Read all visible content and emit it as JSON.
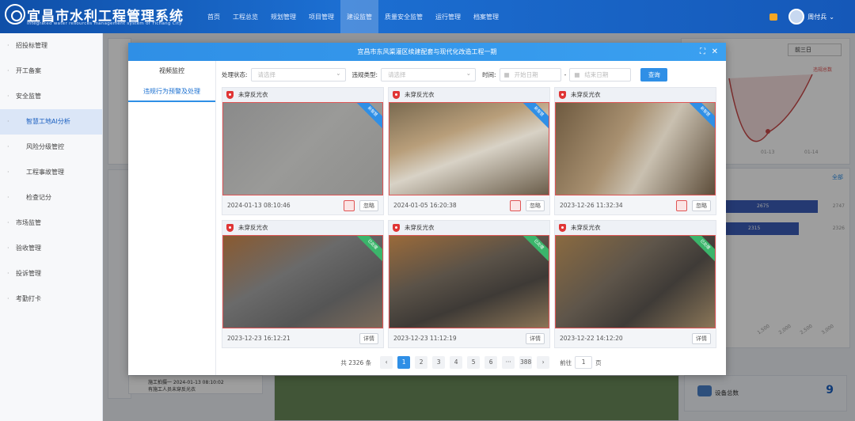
{
  "app": {
    "title": "宜昌市水利工程管理系统",
    "subtitle": "Integrated water resources management system of Yichang City"
  },
  "nav": [
    "首页",
    "工程总览",
    "规划管理",
    "项目管理",
    "建设监管",
    "质量安全监管",
    "运行管理",
    "档案管理"
  ],
  "user": {
    "name": "周付兵"
  },
  "sidebar": {
    "items": [
      "招投标管理",
      "开工备案",
      "安全监管",
      "智慧工地AI分析",
      "风险分级管控",
      "工程事故管理",
      "检查记分",
      "市场监管",
      "验收管理",
      "投诉管理",
      "考勤打卡"
    ]
  },
  "background": {
    "range_select": "前三日",
    "legend": "违规总数",
    "x_ticks": [
      "01-13",
      "01-14"
    ],
    "bar_values": [
      "2675",
      "2315",
      "2747",
      "2326"
    ],
    "all_link": "全部",
    "axis_ticks": [
      "1,500",
      "2,000",
      "2,500",
      "3,000"
    ],
    "device_total_label": "设备总数",
    "device_total": "9",
    "notice_time": "施工拍摄一 2024-01-13 08:10:02",
    "notice_text": "有施工人员未穿反光衣"
  },
  "modal": {
    "title": "宜昌市东风渠灌区续建配套与现代化改造工程一期",
    "tabs": [
      "视频监控",
      "违规行为预警及处理"
    ],
    "filters": {
      "status_label": "处理状态:",
      "status_placeholder": "请选择",
      "type_label": "违规类型:",
      "type_placeholder": "请选择",
      "time_label": "时间:",
      "start_placeholder": "开始日期",
      "dash": "-",
      "end_placeholder": "结束日期",
      "query": "查询"
    },
    "cards": [
      {
        "title": "未穿反光衣",
        "time": "2024-01-13 08:10:46",
        "action": "忽略",
        "ribbon": "新智慧"
      },
      {
        "title": "未穿反光衣",
        "time": "2024-01-05 16:20:38",
        "action": "忽略",
        "ribbon": "新智慧"
      },
      {
        "title": "未穿反光衣",
        "time": "2023-12-26 11:32:34",
        "action": "忽略",
        "ribbon": "新智慧"
      },
      {
        "title": "未穿反光衣",
        "time": "2023-12-23 16:12:21",
        "action": "详情",
        "ribbon": "已处理"
      },
      {
        "title": "未穿反光衣",
        "time": "2023-12-23 11:12:19",
        "action": "详情",
        "ribbon": "已处理"
      },
      {
        "title": "未穿反光衣",
        "time": "2023-12-22 14:12:20",
        "action": "详情",
        "ribbon": "已处理"
      }
    ],
    "pager": {
      "total": "共 2326 条",
      "prev": "‹",
      "pages": [
        "1",
        "2",
        "3",
        "4",
        "5",
        "6",
        "···",
        "388"
      ],
      "next": "›",
      "goto": "前往",
      "page_value": "1",
      "page_unit": "页"
    }
  }
}
